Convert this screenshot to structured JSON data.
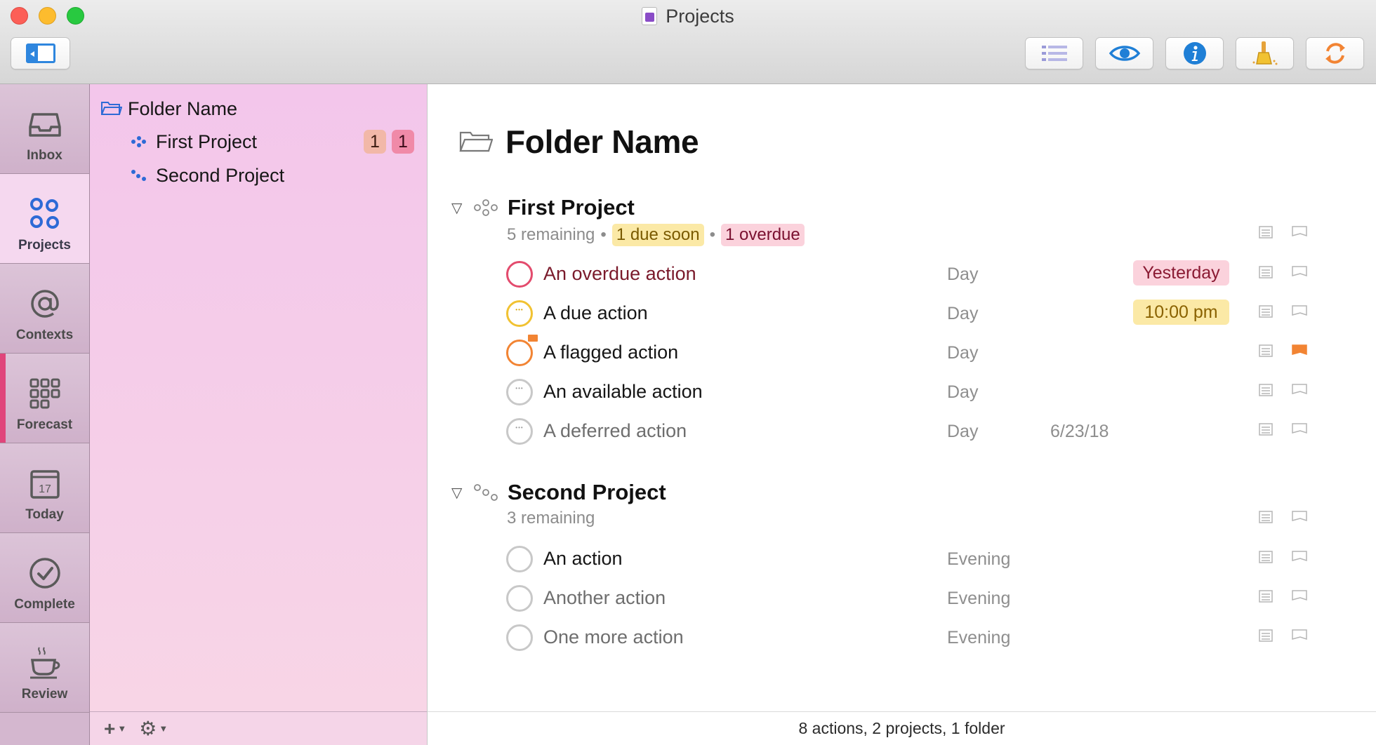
{
  "window": {
    "title": "Projects"
  },
  "toolbar": {
    "buttons": [
      {
        "name": "sidebar-toggle",
        "icon": "sidebar-icon"
      },
      {
        "name": "outline-button",
        "icon": "list-icon"
      },
      {
        "name": "view-options-button",
        "icon": "eye-icon"
      },
      {
        "name": "inspector-button",
        "icon": "info-icon"
      },
      {
        "name": "clean-up-button",
        "icon": "broom-icon"
      },
      {
        "name": "sync-button",
        "icon": "sync-icon"
      }
    ]
  },
  "tabs": [
    {
      "label": "Inbox",
      "icon": "inbox-icon"
    },
    {
      "label": "Projects",
      "icon": "projects-icon",
      "active": true
    },
    {
      "label": "Contexts",
      "icon": "at-sign-icon"
    },
    {
      "label": "Forecast",
      "icon": "grid-icon"
    },
    {
      "label": "Today",
      "icon": "calendar-icon",
      "date": "17"
    },
    {
      "label": "Complete",
      "icon": "checkmark-circle-icon"
    },
    {
      "label": "Review",
      "icon": "coffee-cup-icon"
    }
  ],
  "sidebar": {
    "folder": "Folder Name",
    "projects": [
      {
        "name": "First Project",
        "due_soon_count": "1",
        "overdue_count": "1"
      },
      {
        "name": "Second Project"
      }
    ],
    "footer": {
      "add": "+",
      "settings": "gear"
    }
  },
  "main": {
    "title": "Folder Name",
    "projects": [
      {
        "title": "First Project",
        "remaining": "5 remaining",
        "due_soon": "1 due soon",
        "overdue": "1 overdue",
        "actions": [
          {
            "title": "An overdue action",
            "context": "Day",
            "due": "Yesterday",
            "status": "overdue"
          },
          {
            "title": "A due action",
            "context": "Day",
            "due": "10:00 pm",
            "status": "due"
          },
          {
            "title": "A flagged action",
            "context": "Day",
            "status": "flagged"
          },
          {
            "title": "An available action",
            "context": "Day",
            "status": "available"
          },
          {
            "title": "A deferred action",
            "context": "Day",
            "defer": "6/23/18",
            "status": "deferred"
          }
        ]
      },
      {
        "title": "Second Project",
        "remaining": "3 remaining",
        "actions": [
          {
            "title": "An action",
            "context": "Evening",
            "status": "available"
          },
          {
            "title": "Another action",
            "context": "Evening",
            "status": "available"
          },
          {
            "title": "One more action",
            "context": "Evening",
            "status": "available"
          }
        ]
      }
    ],
    "status": "8 actions, 2 projects, 1 folder"
  },
  "colors": {
    "sidebar_bg": "#f3c6eb",
    "overdue": "#e34b6d",
    "due_soon": "#f1c232",
    "flag": "#f28433",
    "accent": "#2e86de"
  }
}
